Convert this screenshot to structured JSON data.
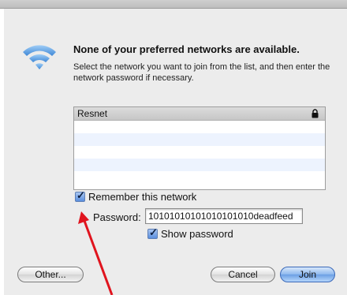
{
  "dialog": {
    "headline": "None of your preferred networks are available.",
    "subtext": "Select the network you want to join from the list, and then enter the network password if necessary.",
    "wifi_icon": "wifi-icon"
  },
  "network_list": {
    "rows": [
      {
        "name": "Resnet",
        "secured": true
      }
    ]
  },
  "remember_network": {
    "label": "Remember this network",
    "checked": true
  },
  "password": {
    "label": "Password:",
    "value": "10101010101010101010deadfeed"
  },
  "show_password": {
    "label": "Show password",
    "checked": true
  },
  "buttons": {
    "other": "Other...",
    "cancel": "Cancel",
    "join": "Join"
  },
  "colors": {
    "accent": "#3a68b8",
    "annotation_arrow": "#e0141e",
    "wifi": "#6aa9e6"
  }
}
